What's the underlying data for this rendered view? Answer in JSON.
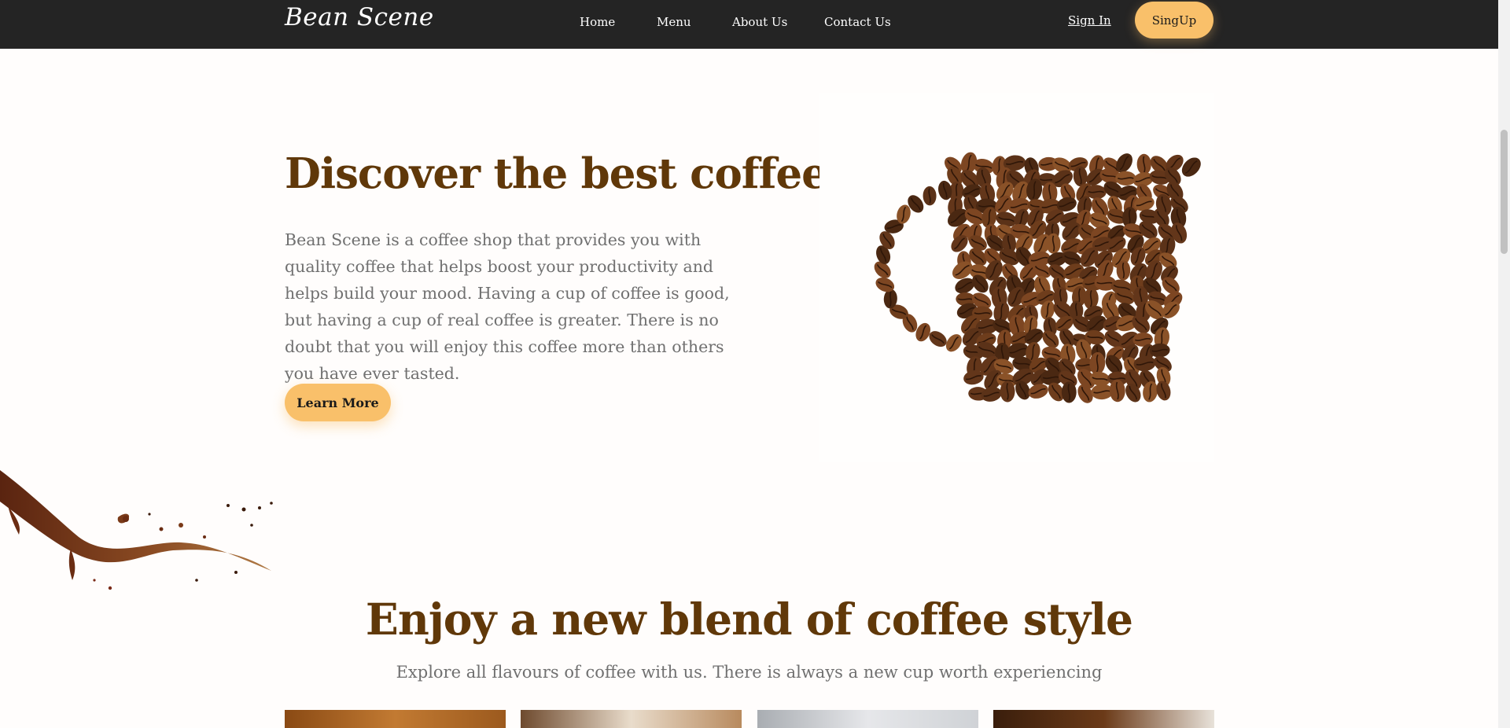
{
  "nav": {
    "logo": "Bean Scene",
    "links": [
      "Home",
      "Menu",
      "About Us",
      "Contact Us"
    ],
    "sign_in": "Sign In",
    "sign_up": "SingUp"
  },
  "hero": {
    "title": "Discover the best coffee",
    "text": "Bean Scene is a coffee shop that provides you with quality coffee that helps boost your productivity and helps build your mood. Having a cup of coffee is good, but having a cup of real coffee is greater. There is no doubt that you will enjoy this coffee more than others you have ever tasted.",
    "button": "Learn More"
  },
  "section": {
    "title": "Enjoy a new blend of coffee style",
    "subtitle": "Explore all flavours of coffee with us. There is always a new cup worth experiencing"
  },
  "colors": {
    "nav_bg": "#242424",
    "accent": "#f9c06a",
    "heading": "#603809",
    "body_text": "#707070"
  }
}
